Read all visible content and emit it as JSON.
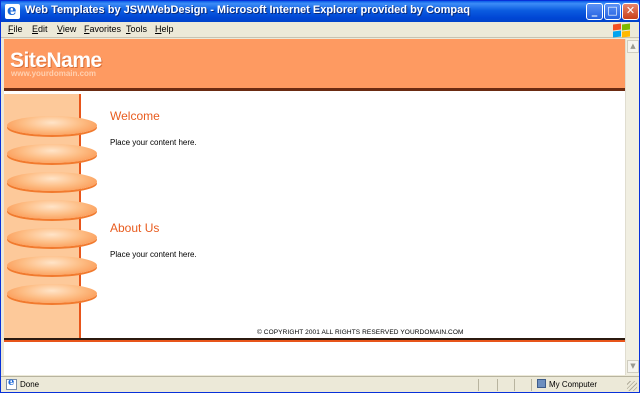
{
  "window": {
    "title": "Web Templates by JSWWebDesign - Microsoft Internet Explorer provided by Compaq",
    "buttons": {
      "minimize": "_",
      "maximize": "□",
      "close": "✕"
    }
  },
  "menu": [
    "File",
    "Edit",
    "View",
    "Favorites",
    "Tools",
    "Help"
  ],
  "page": {
    "site_name": "SiteName",
    "site_domain": "www.yourdomain.com",
    "sections": [
      {
        "title": "Welcome",
        "text": "Place your content here."
      },
      {
        "title": "About Us",
        "text": "Place your content here."
      }
    ],
    "copyright": "© COPYRIGHT 2001 ALL RIGHTS RESERVED YOURDOMAIN.COM",
    "nav_button_count": 7
  },
  "status": {
    "text": "Done",
    "zone": "My Computer"
  },
  "colors": {
    "header": "#fe9a61",
    "accent": "#e85c1f",
    "sidebar": "#fdc99a",
    "title_bar": "#0046d5"
  },
  "icons": [
    "ie-icon",
    "windows-logo-icon",
    "computer-icon"
  ]
}
